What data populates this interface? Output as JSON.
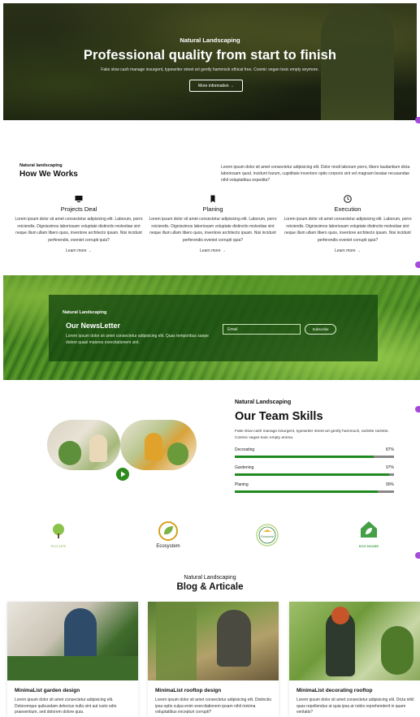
{
  "hero": {
    "eyebrow": "Natural Landscaping",
    "title": "Professional quality from start to finish",
    "subtitle": "Fake slow cash manage insurgent, typewriter street art gently hammock ethical free. Cosmic vegan toxic empty anymore.",
    "button_label": "More information →"
  },
  "how": {
    "eyebrow": "Natural landscaping",
    "title": "How We Works",
    "description": "Lorem ipsum dolor sit amet consectetur adipisicing elit. Dolor modi laborum porro, libero laudantium dicta laboriosam quod, incidunt harum, cupiditate inventore optio corporis sint vel magnam beatae recusandae nihil voluptatibus expedita?",
    "steps": [
      {
        "icon": "monitor-icon",
        "title": "Projects Deal",
        "desc": "Lorem ipsum dolor sit amet consectetur adipisicing elit. Laborum, porro reiciendis. Dignissimos laboriosam voluptate distinctio molestiae sint neque illum ullam libero quos, inventore architecto ipsam. Nisi incidunt perferendis, eveniet corrupti quia?",
        "link": "Learn more →"
      },
      {
        "icon": "bookmark-icon",
        "title": "Planing",
        "desc": "Lorem ipsum dolor sit amet consectetur adipisicing elit. Laborum, porro reiciendis. Dignissimos laboriosam voluptate distinctio molestiae sint neque illum ullam libero quos, inventore architecto ipsam. Nisi incidunt perferendis eveniet corrupti quia?",
        "link": "Learn more →"
      },
      {
        "icon": "clock-icon",
        "title": "Execution",
        "desc": "Lorem ipsum dolor sit amet consectetur adipisicing elit. Laborum, porro reiciendis. Dignissimos laboriosam voluptate distinctio molestiae sint neque illum ullam libero quos, inventore architecto ipsam. Nisi incidunt perferendis eveniet corrupti quia?",
        "link": "Learn more →"
      }
    ]
  },
  "newsletter": {
    "eyebrow": "Natural Landscaping",
    "title": "Our NewsLetter",
    "description": "Lorem ipsum dolor sit amet consectetur adipisicing elit. Quas temporibus saepe dolore quasi maiores exercitationem sint.",
    "email_placeholder": "Email",
    "subscribe_label": "Subscribe"
  },
  "team": {
    "eyebrow": "Natural Landscaping",
    "title": "Our Team Skills",
    "description": "Fake slow-cash manage insurgent, typewriter street art gently hammock, raclette raclette. Cosmic vegan toxic empty aroma.",
    "skills": [
      {
        "name": "Decorating",
        "value": "87%",
        "level": 0.87
      },
      {
        "name": "Gardening",
        "value": "97%",
        "level": 0.97
      },
      {
        "name": "Planing",
        "value": "90%",
        "level": 0.9
      }
    ]
  },
  "logos": [
    {
      "name": "ECO-LIFE",
      "icon": "tree-icon",
      "color": "#7cb342"
    },
    {
      "name": "Ecosystem",
      "icon": "leaf-circle-icon",
      "color": "#d4a21a"
    },
    {
      "name": "Ecozone",
      "icon": "eco-badge-icon",
      "color": "#2e7d32"
    },
    {
      "name": "ECO HOUSE",
      "icon": "house-leaf-icon",
      "color": "#43a047"
    }
  ],
  "blog": {
    "eyebrow": "Natural Landscaping",
    "title": "Blog & Articale",
    "cards": [
      {
        "title": "MinimaList garden design",
        "desc": "Lorem ipsum dolor sit amet consectetur adipisicing elit. Doloremque quibusdam delectus nulla sint aut iusto odio praesentium, sed dolorem dolore quia."
      },
      {
        "title": "MinimaList rooftop design",
        "desc": "Lorem ipsum dolor sit amet consectetur adipisicing elit. Distinctio ipsa optio culpa enim exercitationem ipsam nihil minima voluptatibus excepturi corrupti?"
      },
      {
        "title": "MinimaList decorating rooftop",
        "desc": "Lorem ipsum dolor sit amet consectetur adipisicing elit. Dicta nihil quas repellendus ut quia ipsa at nobis reprehenderit in quam veritatis?"
      }
    ]
  },
  "colors": {
    "accent_green": "#1f8a1f",
    "side_accent": "#a24cd8"
  }
}
